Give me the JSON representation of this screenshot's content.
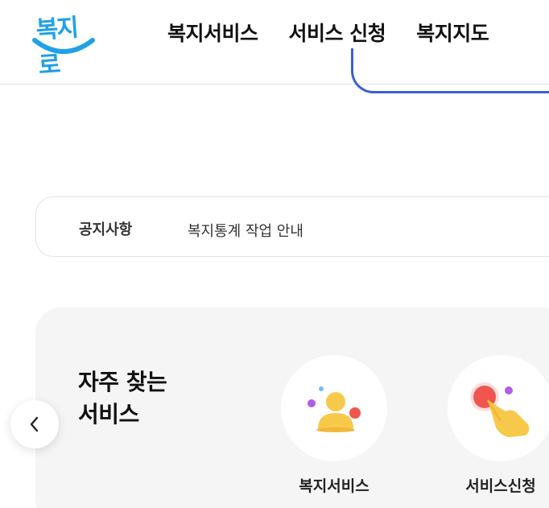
{
  "header": {
    "logo_text": "복지로",
    "nav": [
      "복지서비스",
      "서비스 신청",
      "복지지도"
    ]
  },
  "notice": {
    "label": "공지사항",
    "text": "복지통계 작업 안내"
  },
  "favorites": {
    "title_line1": "자주 찾는",
    "title_line2": "서비스",
    "services": [
      {
        "label": "복지서비스",
        "icon": "person-icon"
      },
      {
        "label": "서비스신청",
        "icon": "tap-hand-icon"
      }
    ]
  },
  "colors": {
    "logo_blue": "#21a1e5",
    "accent_blue": "#3e5fd1",
    "panel_bg": "#f5f5f5"
  }
}
